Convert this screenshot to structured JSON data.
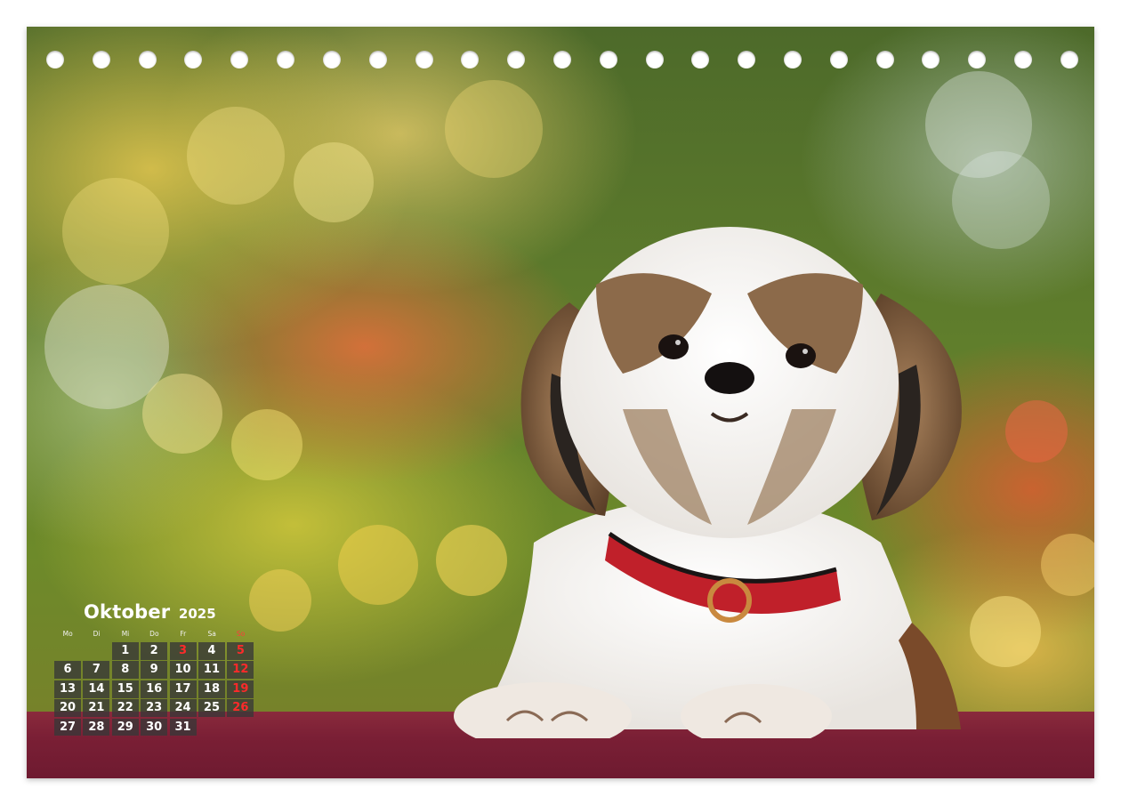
{
  "calendar": {
    "month": "Oktober",
    "year": "2025",
    "weekdays": [
      "Mo",
      "Di",
      "Mi",
      "Do",
      "Fr",
      "Sa",
      "So"
    ],
    "leading_blanks": 2,
    "days": [
      "1",
      "2",
      "3",
      "4",
      "5",
      "6",
      "7",
      "8",
      "9",
      "10",
      "11",
      "12",
      "13",
      "14",
      "15",
      "16",
      "17",
      "18",
      "19",
      "20",
      "21",
      "22",
      "23",
      "24",
      "25",
      "26",
      "27",
      "28",
      "29",
      "30",
      "31"
    ],
    "red_days": [
      "3",
      "5",
      "12",
      "19",
      "26"
    ],
    "colors": {
      "cell_background": "#373737",
      "sunday_text": "#ff2a2a",
      "text": "#ffffff"
    }
  },
  "binding": {
    "hole_count": 23
  },
  "photo": {
    "subject": "dog-photo",
    "colors": {
      "table": "#7a1f35",
      "collar": "#c0202a"
    }
  }
}
